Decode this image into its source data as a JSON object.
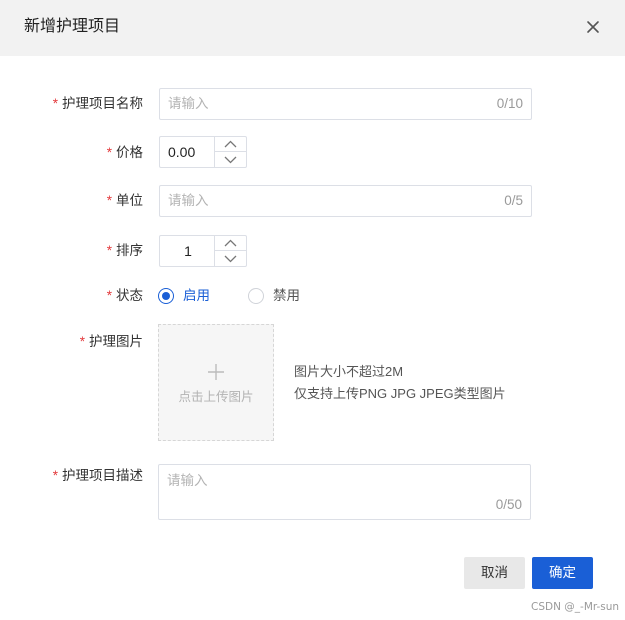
{
  "dialog": {
    "title": "新增护理项目",
    "close_icon": "close-icon"
  },
  "form": {
    "name": {
      "required_mark": "*",
      "label": "护理项目名称",
      "placeholder": "请输入",
      "counter": "0/10"
    },
    "price": {
      "required_mark": "*",
      "label": "价格",
      "value": "0.00"
    },
    "unit": {
      "required_mark": "*",
      "label": "单位",
      "placeholder": "请输入",
      "counter": "0/5"
    },
    "sort": {
      "required_mark": "*",
      "label": "排序",
      "value": "1"
    },
    "status": {
      "required_mark": "*",
      "label": "状态",
      "options": [
        {
          "label": "启用",
          "checked": true
        },
        {
          "label": "禁用",
          "checked": false
        }
      ]
    },
    "image": {
      "required_mark": "*",
      "label": "护理图片",
      "upload_text": "点击上传图片",
      "hint_line1": "图片大小不超过2M",
      "hint_line2": "仅支持上传PNG JPG JPEG类型图片"
    },
    "description": {
      "required_mark": "*",
      "label": "护理项目描述",
      "placeholder": "请输入",
      "counter": "0/50"
    }
  },
  "footer": {
    "cancel_label": "取消",
    "confirm_label": "确定"
  },
  "watermark": "CSDN @_-Mr-sun",
  "colors": {
    "primary": "#1a5fd6",
    "required": "#e3393c",
    "header_bg": "#f2f2f2"
  }
}
